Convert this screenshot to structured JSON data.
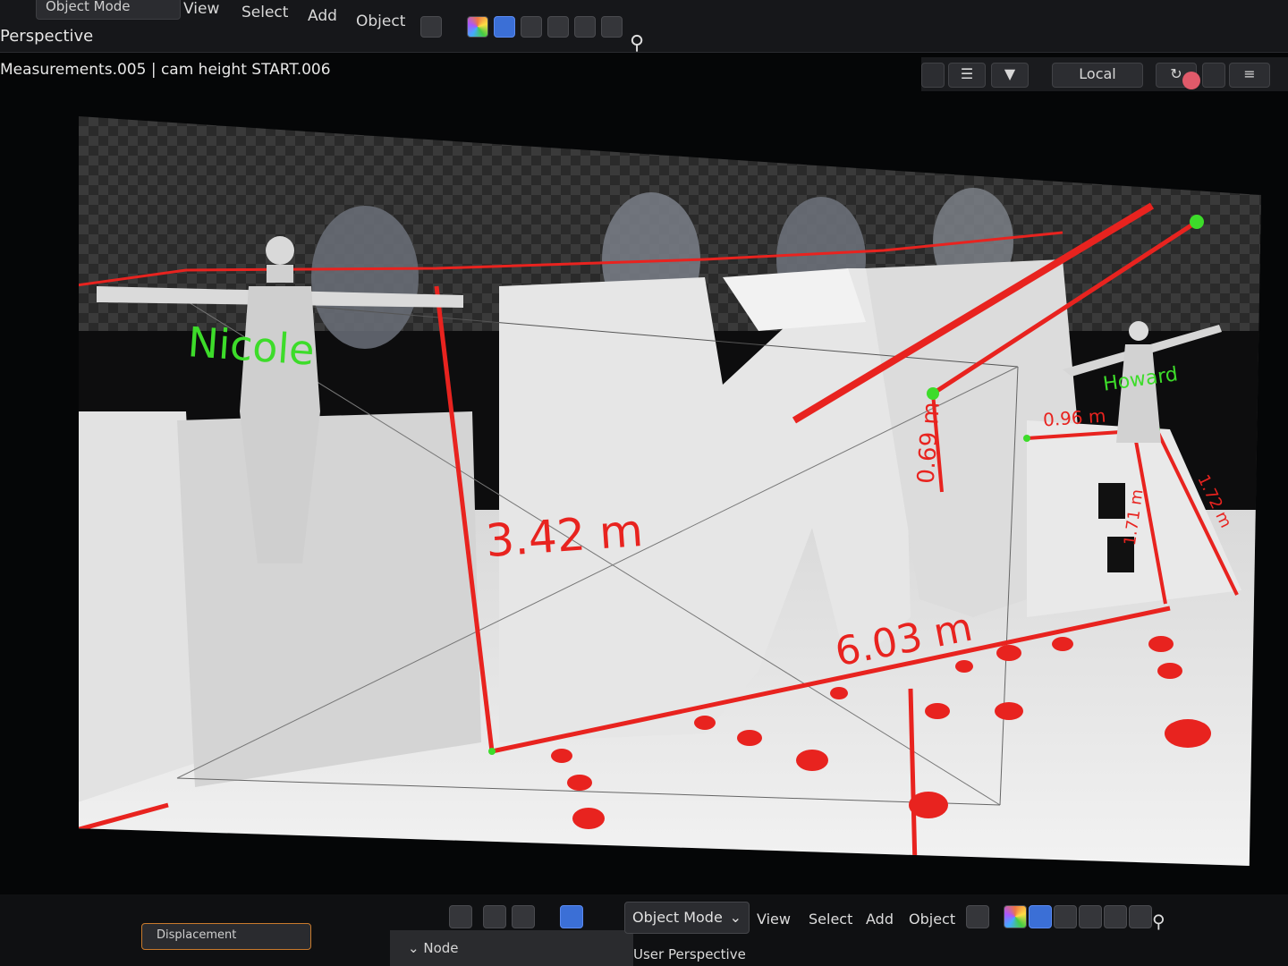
{
  "top_header": {
    "mode_label": "Object Mode",
    "menus": [
      "View",
      "Select",
      "Add",
      "Object"
    ],
    "viewport_name": "Perspective",
    "active_objects": "Measurements.005 | cam height START.006"
  },
  "right_toolbar": {
    "transform_orientation": "Local"
  },
  "viewport": {
    "person_labels": [
      "Nicole",
      "Howard"
    ],
    "measurements": [
      "3.42 m",
      "6.03 m",
      "0.69 m",
      "0.96 m",
      "1.71 m",
      "1.72 m"
    ],
    "colors": {
      "measure_line": "#e8231f",
      "label_green": "#3ddc2a",
      "model_white": "#e9e9e9"
    }
  },
  "bottom_header": {
    "modifier_field": "Displacement",
    "node_label": "Node",
    "mode_label": "Object Mode",
    "menus": [
      "View",
      "Select",
      "Add",
      "Object"
    ],
    "viewport_name": "User Perspective"
  }
}
